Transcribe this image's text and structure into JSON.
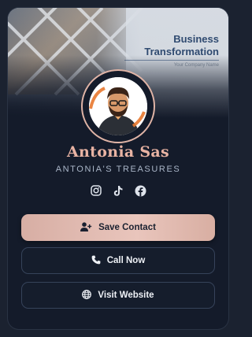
{
  "banner": {
    "title_line1": "Business",
    "title_line2": "Transformation",
    "tagline": "Your Company Name"
  },
  "profile": {
    "name": "Antonia Sas",
    "company": "ANTONIA'S TREASURES",
    "avatar_icon": "person-avatar"
  },
  "socials": [
    {
      "icon": "instagram-icon"
    },
    {
      "icon": "tiktok-icon"
    },
    {
      "icon": "facebook-icon"
    }
  ],
  "actions": {
    "save_label": "Save Contact",
    "call_label": "Call Now",
    "website_label": "Visit Website"
  },
  "colors": {
    "accent": "#e8b3a3",
    "background": "#1b2230",
    "card": "#141b2a",
    "button_border": "#36435a"
  }
}
